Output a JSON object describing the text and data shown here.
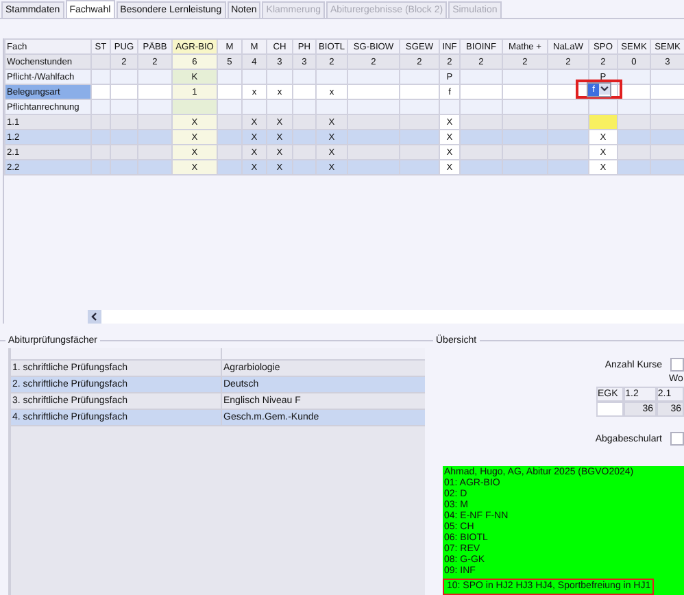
{
  "tabs": [
    {
      "label": "Stammdaten",
      "selected": false,
      "disabled": false
    },
    {
      "label": "Fachwahl",
      "selected": true,
      "disabled": false
    },
    {
      "label": "Besondere Lernleistung",
      "selected": false,
      "disabled": false
    },
    {
      "label": "Noten",
      "selected": false,
      "disabled": false
    },
    {
      "label": "Klammerung",
      "selected": false,
      "disabled": true
    },
    {
      "label": "Abiturergebnisse (Block 2)",
      "selected": false,
      "disabled": true
    },
    {
      "label": "Simulation",
      "selected": false,
      "disabled": true
    }
  ],
  "grid": {
    "row_header_label": "Fach",
    "columns": [
      {
        "label": "ST",
        "highlighted": false
      },
      {
        "label": "PUG",
        "highlighted": false
      },
      {
        "label": "PÄBB",
        "highlighted": false
      },
      {
        "label": "AGR-BIO",
        "highlighted": true
      },
      {
        "label": "M",
        "highlighted": false
      },
      {
        "label": "M",
        "highlighted": false
      },
      {
        "label": "CH",
        "highlighted": false
      },
      {
        "label": "PH",
        "highlighted": false
      },
      {
        "label": "BIOTL",
        "highlighted": false
      },
      {
        "label": "SG-BIOW",
        "highlighted": false
      },
      {
        "label": "SGEW",
        "highlighted": false
      },
      {
        "label": "INF",
        "highlighted": false,
        "editable": true
      },
      {
        "label": "BIOINF",
        "highlighted": false
      },
      {
        "label": "Mathe +",
        "highlighted": false
      },
      {
        "label": "NaLaW",
        "highlighted": false
      },
      {
        "label": "SPO",
        "highlighted": false,
        "editable": true
      },
      {
        "label": "SEMK",
        "highlighted": false
      },
      {
        "label": "SEMK",
        "highlighted": false
      }
    ],
    "rows": [
      {
        "label": "Wochenstunden",
        "kind": "hours",
        "selected": false,
        "cells": [
          "",
          "2",
          "2",
          "6",
          "5",
          "4",
          "3",
          "3",
          "2",
          "2",
          "2",
          "2",
          "2",
          "2",
          "2",
          "2",
          "0",
          "3"
        ]
      },
      {
        "label": "Pflicht-/Wahlfach",
        "kind": "choice",
        "selected": false,
        "cells": [
          "",
          "",
          "",
          "K",
          "",
          "",
          "",
          "",
          "",
          "",
          "",
          "P",
          "",
          "",
          "",
          "P",
          "",
          ""
        ]
      },
      {
        "label": "Belegungsart",
        "kind": "entry",
        "selected": true,
        "cells": [
          "",
          "",
          "",
          "1",
          "",
          "x",
          "x",
          "",
          "x",
          "",
          "",
          "f",
          "",
          "",
          "",
          {
            "kind": "dropdown",
            "text": "f"
          },
          "",
          ""
        ]
      },
      {
        "label": "Pflichtanrechnung",
        "kind": "choice",
        "selected": false,
        "cells": [
          "",
          "",
          "",
          "",
          "",
          "",
          "",
          "",
          "",
          "",
          "",
          "",
          "",
          "",
          "",
          "",
          "",
          ""
        ]
      },
      {
        "label": "1.1",
        "kind": "period",
        "selected": false,
        "cells": [
          "",
          "",
          "",
          "X",
          "",
          "X",
          "X",
          "",
          "X",
          "",
          "",
          "X",
          "",
          "",
          "",
          {
            "kind": "warning"
          },
          "",
          ""
        ]
      },
      {
        "label": "1.2",
        "kind": "period",
        "selected": false,
        "cells": [
          "",
          "",
          "",
          "X",
          "",
          "X",
          "X",
          "",
          "X",
          "",
          "",
          "X",
          "",
          "",
          "",
          "X",
          "",
          ""
        ]
      },
      {
        "label": "2.1",
        "kind": "period",
        "selected": false,
        "cells": [
          "",
          "",
          "",
          "X",
          "",
          "X",
          "X",
          "",
          "X",
          "",
          "",
          "X",
          "",
          "",
          "",
          "X",
          "",
          ""
        ]
      },
      {
        "label": "2.2",
        "kind": "period",
        "selected": false,
        "cells": [
          "",
          "",
          "",
          "X",
          "",
          "X",
          "X",
          "",
          "X",
          "",
          "",
          "X",
          "",
          "",
          "",
          "X",
          "",
          ""
        ]
      }
    ]
  },
  "exam_subjects": {
    "title": "Abiturprüfungsfächer",
    "rows": [
      {
        "label": "1. schriftliche Prüfungsfach",
        "subject": "Agrarbiologie"
      },
      {
        "label": "2. schriftliche Prüfungsfach",
        "subject": "Deutsch"
      },
      {
        "label": "3. schriftliche Prüfungsfach",
        "subject": "Englisch Niveau F"
      },
      {
        "label": "4. schriftliche Prüfungsfach",
        "subject": "Gesch.m.Gem.-Kunde"
      }
    ]
  },
  "overview": {
    "title": "Übersicht",
    "course_count_label": "Anzahl Kurse",
    "column_caption": "Wo",
    "hours_table": {
      "columns": [
        "EGK",
        "1.2",
        "2.1"
      ],
      "values": [
        "36",
        "36"
      ]
    },
    "school_type_label": "Abgabeschulart",
    "summary_lines": [
      {
        "text": "Ahmad, Hugo, AG, Abitur 2025 (BGVO2024)",
        "highlighted": false
      },
      {
        "text": "01: AGR-BIO",
        "highlighted": false
      },
      {
        "text": "02: D",
        "highlighted": false
      },
      {
        "text": "03: M",
        "highlighted": false
      },
      {
        "text": "04: E-NF F-NN",
        "highlighted": false
      },
      {
        "text": "05: CH",
        "highlighted": false
      },
      {
        "text": "06: BIOTL",
        "highlighted": false
      },
      {
        "text": "07: REV",
        "highlighted": false
      },
      {
        "text": "08: G-GK",
        "highlighted": false
      },
      {
        "text": "09: INF",
        "highlighted": false
      },
      {
        "text": "10: SPO in HJ2 HJ3 HJ4, Sportbefreiung in HJ1",
        "highlighted": true
      }
    ]
  }
}
